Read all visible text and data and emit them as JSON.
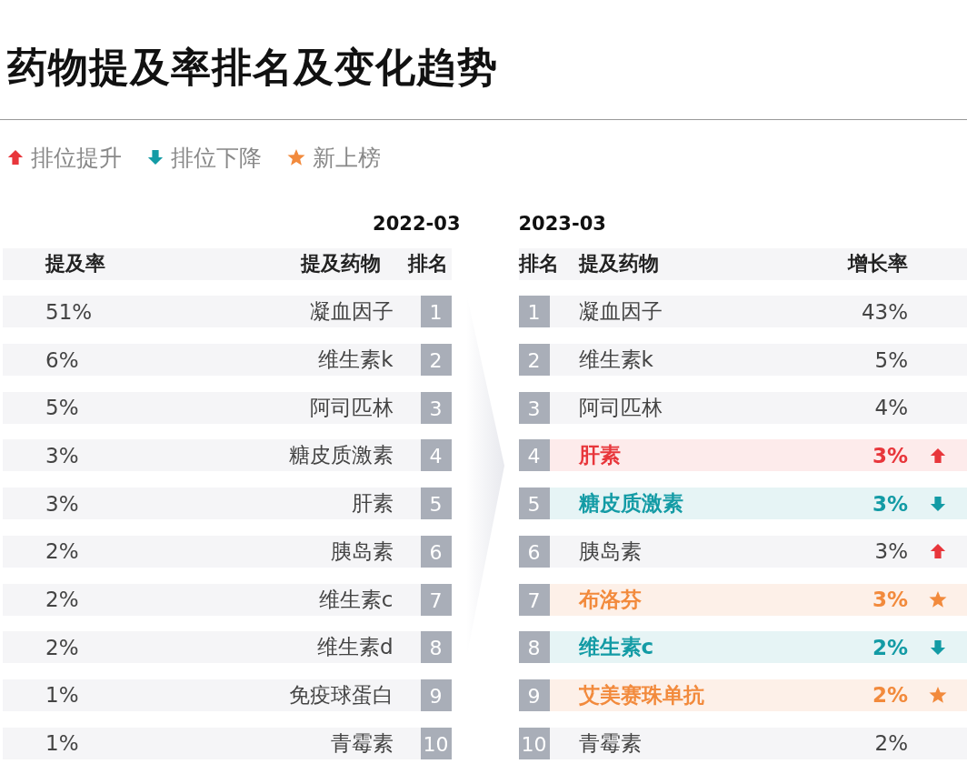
{
  "title": "药物提及率排名及变化趋势",
  "legend": [
    {
      "kind": "up",
      "label": "排位提升"
    },
    {
      "kind": "down",
      "label": "排位下降"
    },
    {
      "kind": "new",
      "label": "新上榜"
    }
  ],
  "before": {
    "period": "2022-03",
    "columns": [
      "提及率",
      "提及药物",
      "排名"
    ],
    "rows": [
      {
        "rate": "51%",
        "drug": "凝血因子",
        "rank": "1"
      },
      {
        "rate": "6%",
        "drug": "维生素k",
        "rank": "2"
      },
      {
        "rate": "5%",
        "drug": "阿司匹林",
        "rank": "3"
      },
      {
        "rate": "3%",
        "drug": "糖皮质激素",
        "rank": "4"
      },
      {
        "rate": "3%",
        "drug": "肝素",
        "rank": "5"
      },
      {
        "rate": "2%",
        "drug": "胰岛素",
        "rank": "6"
      },
      {
        "rate": "2%",
        "drug": "维生素c",
        "rank": "7"
      },
      {
        "rate": "2%",
        "drug": "维生素d",
        "rank": "8"
      },
      {
        "rate": "1%",
        "drug": "免疫球蛋白",
        "rank": "9"
      },
      {
        "rate": "1%",
        "drug": "青霉素",
        "rank": "10"
      }
    ]
  },
  "after": {
    "period": "2023-03",
    "columns": [
      "排名",
      "提及药物",
      "增长率"
    ],
    "rows": [
      {
        "rank": "1",
        "drug": "凝血因子",
        "growth": "43%",
        "kind": "plain",
        "highlighted": false
      },
      {
        "rank": "2",
        "drug": "维生素k",
        "growth": "5%",
        "kind": "plain",
        "highlighted": false
      },
      {
        "rank": "3",
        "drug": "阿司匹林",
        "growth": "4%",
        "kind": "plain",
        "highlighted": false
      },
      {
        "rank": "4",
        "drug": "肝素",
        "growth": "3%",
        "kind": "up",
        "highlighted": true
      },
      {
        "rank": "5",
        "drug": "糖皮质激素",
        "growth": "3%",
        "kind": "down",
        "highlighted": true
      },
      {
        "rank": "6",
        "drug": "胰岛素",
        "growth": "3%",
        "kind": "up",
        "highlighted": false
      },
      {
        "rank": "7",
        "drug": "布洛芬",
        "growth": "3%",
        "kind": "new",
        "highlighted": true
      },
      {
        "rank": "8",
        "drug": "维生素c",
        "growth": "2%",
        "kind": "down",
        "highlighted": true
      },
      {
        "rank": "9",
        "drug": "艾美赛珠单抗",
        "growth": "2%",
        "kind": "new",
        "highlighted": true
      },
      {
        "rank": "10",
        "drug": "青霉素",
        "growth": "2%",
        "kind": "plain",
        "highlighted": false
      }
    ]
  }
}
